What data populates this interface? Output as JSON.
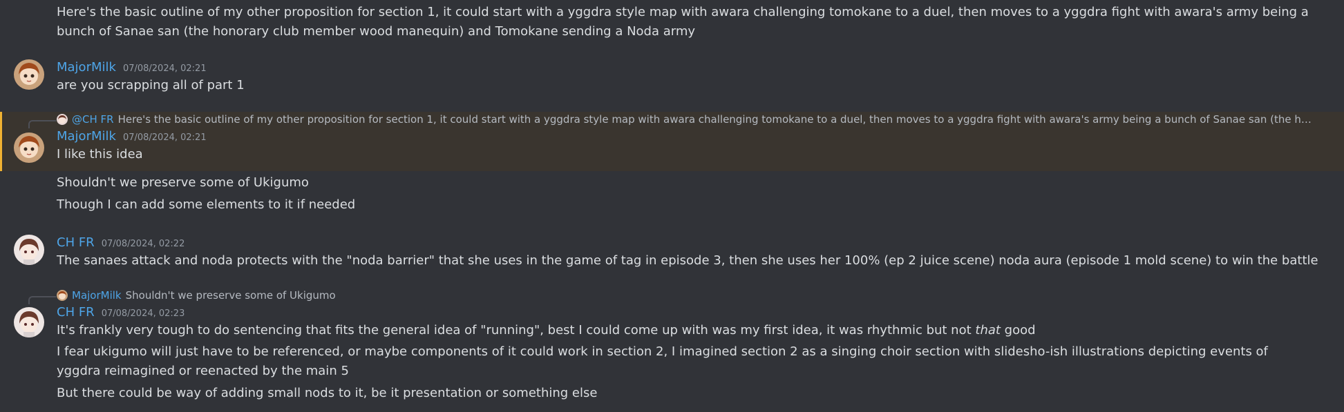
{
  "messages": [
    {
      "lines": [
        "Here's the basic outline of my other proposition for section 1, it could start with a yggdra style map with awara challenging tomokane to a duel, then moves to a yggdra fight with awara's army being a bunch of Sanae san (the honorary club member wood manequin) and Tomokane sending a Noda army"
      ]
    },
    {
      "author": "MajorMilk",
      "timestamp": "07/08/2024, 02:21",
      "lines": [
        "are you scrapping all of part 1"
      ]
    },
    {
      "reply": {
        "author": "@CH FR",
        "text": "Here's the basic outline of my other proposition for section 1, it could start with a yggdra style map with awara challenging tomokane to a duel, then moves to a yggdra fight with awara's army being a bunch of Sanae san (the honorary club ..."
      },
      "author": "MajorMilk",
      "timestamp": "07/08/2024, 02:21",
      "lines": [
        "I like this idea",
        "Shouldn't we preserve some of Ukigumo",
        "Though I can add some elements to it if needed"
      ]
    },
    {
      "author": "CH FR",
      "timestamp": "07/08/2024, 02:22",
      "lines": [
        "The sanaes attack and noda protects with the \"noda barrier\" that she uses in the game of tag in episode 3, then she uses her 100% (ep 2 juice scene) noda aura (episode 1 mold scene) to win the battle"
      ]
    },
    {
      "reply": {
        "author": "MajorMilk",
        "text": "Shouldn't we preserve some of Ukigumo"
      },
      "author": "CH FR",
      "timestamp": "07/08/2024, 02:23",
      "line1_pre": "It's frankly very tough to do sentencing that fits the general idea of \"running\", best I could come up with was my first idea, it was rhythmic but not ",
      "line1_em": "that",
      "line1_post": " good",
      "lines": [
        "I fear ukigumo will just have to be referenced, or maybe components of it could work in section 2, I imagined section 2 as a singing choir section with slidesho-ish illustrations depicting events of yggdra reimagined or reenacted by the main 5",
        "But there could be way of adding small nods to it, be it presentation or something else"
      ]
    }
  ],
  "colors": {
    "background": "#313338",
    "author": "#4ea5e8",
    "timestamp": "#949ba4",
    "text": "#dbdee1",
    "highlight_bar": "#f0b232"
  }
}
